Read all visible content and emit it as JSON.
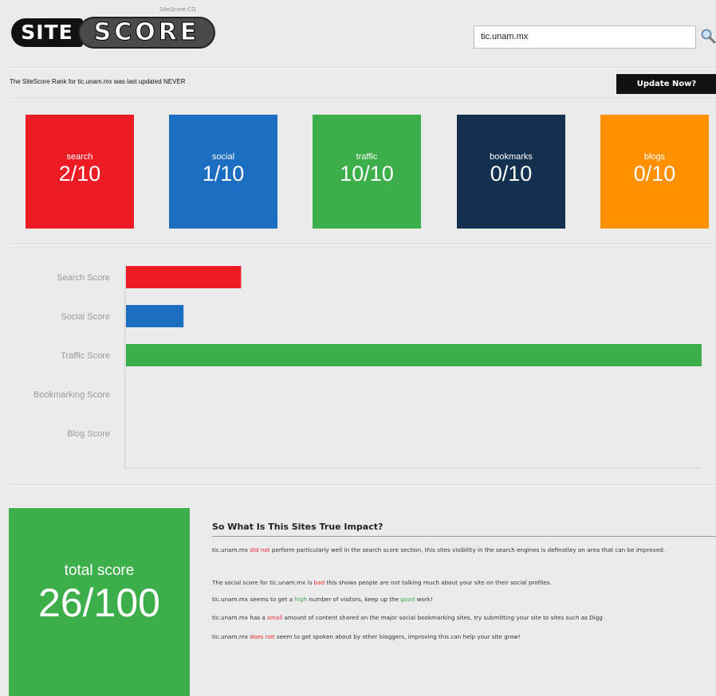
{
  "header": {
    "logo_tag": "SiteScore.CO",
    "logo_site": "SITE",
    "logo_score": "SCORE",
    "search_value": "tic.unam.mx"
  },
  "status": {
    "updated_text": "The SiteScore Rank for tic.unam.mx was last updated NEVER",
    "update_button": "Update Now?"
  },
  "tiles": [
    {
      "label": "search",
      "value": "2/10",
      "color": "#ed1c24"
    },
    {
      "label": "social",
      "value": "1/10",
      "color": "#1c6ec0"
    },
    {
      "label": "traffic",
      "value": "10/10",
      "color": "#3cae4a"
    },
    {
      "label": "bookmarks",
      "value": "0/10",
      "color": "#14304f"
    },
    {
      "label": "blogs",
      "value": "0/10",
      "color": "#ff9000"
    }
  ],
  "chart_data": {
    "type": "bar",
    "orientation": "horizontal",
    "categories": [
      "Search Score",
      "Social Score",
      "Traffic Score",
      "Bookmarking Score",
      "Blog Score"
    ],
    "values": [
      2,
      1,
      10,
      0,
      0
    ],
    "colors": [
      "#ed1c24",
      "#1c6ec0",
      "#3cae4a",
      "#14304f",
      "#ff9000"
    ],
    "xlim": [
      0,
      10
    ],
    "grid": false
  },
  "total": {
    "label": "total score",
    "value": "26/100"
  },
  "impact": {
    "title": "So What Is This Sites True Impact?",
    "p1_a": "tic.unam.mx ",
    "p1_b": "did not",
    "p1_c": " perform particularly well in the search score section, this sites visibility in the search engines is definatley an area that can be improved.",
    "p2_a": "The social score for tic.unam.mx is ",
    "p2_b": "bad",
    "p2_c": " this shows people are not talking much about your site on their social profiles.",
    "p3_a": "tic.unam.mx seems to get a ",
    "p3_b": "high",
    "p3_c": " number of visitors, keep up the ",
    "p3_d": "good",
    "p3_e": " work!",
    "p4_a": "tic.unam.mx has a ",
    "p4_b": "small",
    "p4_c": " amount of content shared on the major social bookmarking sites, try submitting your site to sites such as Digg",
    "p5_a": "tic.unam.mx ",
    "p5_b": "does not",
    "p5_c": " seem to get spoken about by other bloggers, improving this can help your site grow!"
  }
}
